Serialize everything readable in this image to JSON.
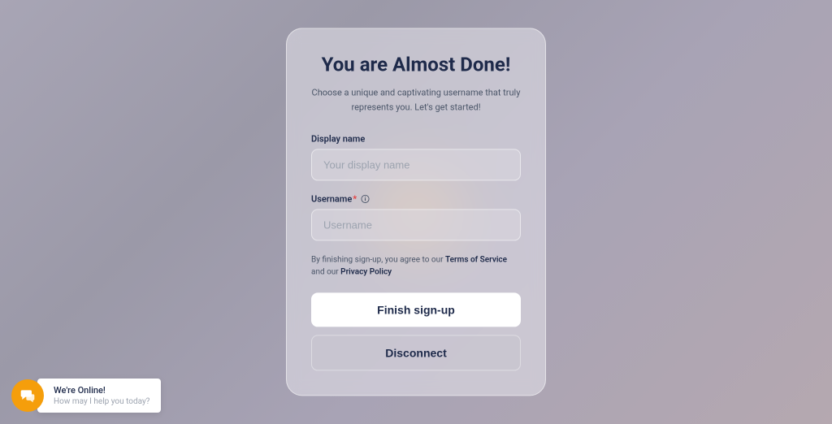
{
  "modal": {
    "title": "You are Almost Done!",
    "subtitle": "Choose a unique and captivating username that truly represents you. Let's get started!",
    "display_name": {
      "label": "Display name",
      "placeholder": "Your display name",
      "value": ""
    },
    "username": {
      "label": "Username",
      "placeholder": "Username",
      "value": ""
    },
    "legal": {
      "prefix": "By finishing sign-up, you agree to our ",
      "tos": "Terms of Service",
      "middle": " and our ",
      "privacy": "Privacy Policy"
    },
    "buttons": {
      "finish": "Finish sign-up",
      "disconnect": "Disconnect"
    }
  },
  "chat": {
    "title": "We're Online!",
    "subtitle": "How may I help you today?"
  }
}
